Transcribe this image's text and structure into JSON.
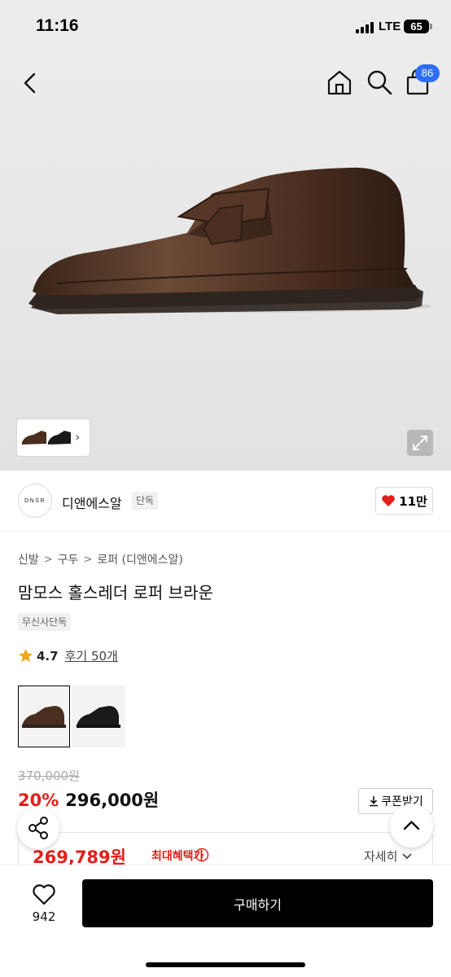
{
  "status_bar": {
    "time": "11:16",
    "network": "LTE",
    "battery": "65"
  },
  "header": {
    "cart_count": "86"
  },
  "brand": {
    "logo_text": "DNSR",
    "name": "디앤에스알",
    "tag": "단독",
    "like_count": "11만"
  },
  "breadcrumb": [
    "신발",
    "구두",
    "로퍼 (디앤에스알)"
  ],
  "product": {
    "title": "맘모스 홀스레더 로퍼 브라운",
    "badge": "무신사단독",
    "rating": "4.7",
    "reviews_label": "후기 50개",
    "original_price": "370,000원",
    "discount": "20%",
    "price": "296,000원",
    "coupon_label": "쿠폰받기",
    "max_benefit_price": "269,789원",
    "max_benefit_label": "최대혜택가",
    "detail_label": "자세히"
  },
  "bottom": {
    "wish_count": "942",
    "buy_label": "구매하기"
  },
  "colors": {
    "accent_red": "#e0201a",
    "badge_blue": "#2f6df6",
    "shoe_brown": "#4a2e1f"
  },
  "icons": [
    "back-icon",
    "home-icon",
    "search-icon",
    "cart-icon",
    "expand-icon",
    "heart-icon",
    "star-icon",
    "download-icon",
    "info-icon",
    "share-icon",
    "chevron-up-icon",
    "chevron-down-icon"
  ]
}
